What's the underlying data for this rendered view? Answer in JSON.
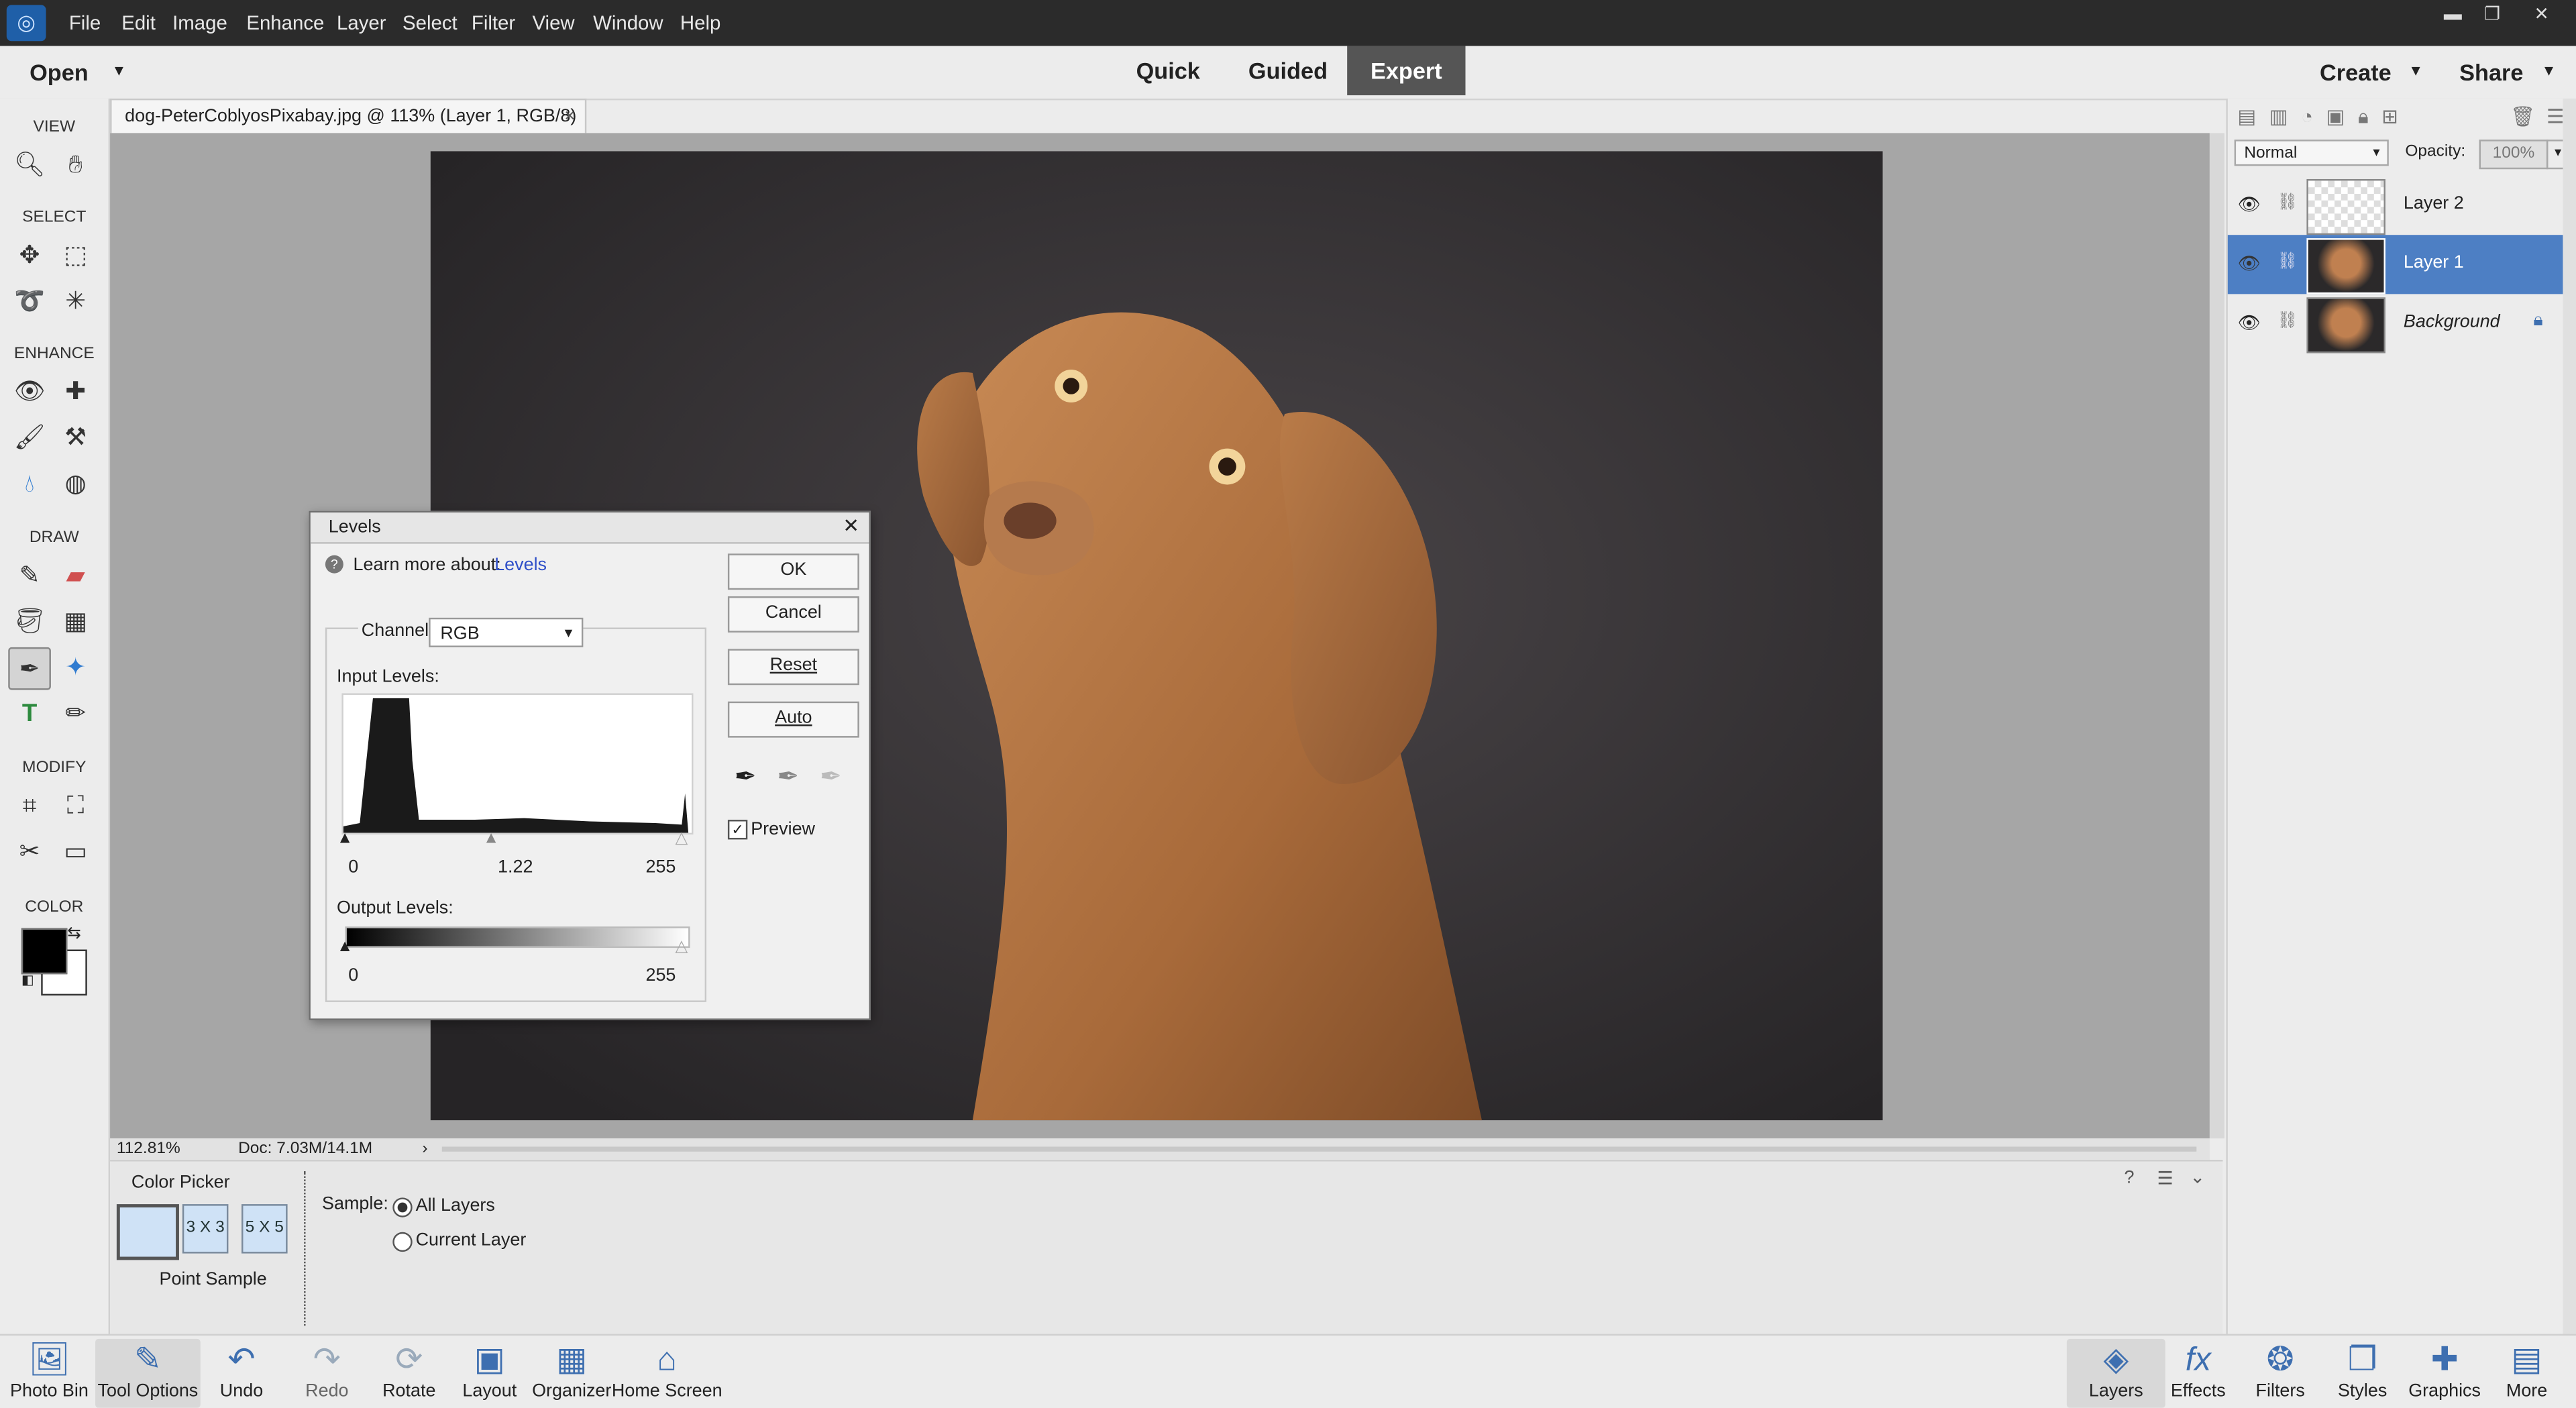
{
  "menubar": {
    "items": [
      "File",
      "Edit",
      "Image",
      "Enhance",
      "Layer",
      "Select",
      "Filter",
      "View",
      "Window",
      "Help"
    ]
  },
  "modebar": {
    "open_label": "Open",
    "tabs": [
      "Quick",
      "Guided",
      "Expert"
    ],
    "active_tab": "Expert",
    "create_label": "Create",
    "share_label": "Share"
  },
  "toolbox": {
    "sections": [
      "VIEW",
      "SELECT",
      "ENHANCE",
      "DRAW",
      "MODIFY",
      "COLOR"
    ]
  },
  "document": {
    "tab_title": "dog-PeterCoblyosPixabay.jpg @ 113% (Layer 1, RGB/8) *",
    "close_glyph": "×"
  },
  "statusbar": {
    "zoom": "112.81%",
    "doc_info": "Doc: 7.03M/14.1M",
    "arrow": "›"
  },
  "tool_options": {
    "tool_name": "Color Picker",
    "sample_sizes": [
      "3 X 3",
      "5 X 5"
    ],
    "selected_size_label": "Point Sample",
    "sample_label": "Sample:",
    "sample_options": [
      "All Layers",
      "Current Layer"
    ],
    "selected_sample": "All Layers"
  },
  "layers_panel": {
    "blend_mode": "Normal",
    "opacity_label": "Opacity:",
    "opacity_value": "100%",
    "layers": [
      {
        "name": "Layer 2",
        "selected": false
      },
      {
        "name": "Layer 1",
        "selected": true
      },
      {
        "name": "Background",
        "selected": false
      }
    ]
  },
  "levels_dialog": {
    "title": "Levels",
    "learn_more_label": "Learn more about:",
    "learn_more_link": "Levels",
    "channel_label": "Channel:",
    "channel_value": "RGB",
    "input_levels_label": "Input Levels:",
    "input_values": [
      "0",
      "1.22",
      "255"
    ],
    "output_levels_label": "Output Levels:",
    "output_values": [
      "0",
      "255"
    ],
    "buttons": {
      "ok": "OK",
      "cancel": "Cancel",
      "reset": "Reset",
      "auto": "Auto"
    },
    "preview_label": "Preview",
    "preview_checked": true
  },
  "bottombar": {
    "left": [
      "Photo Bin",
      "Tool Options",
      "Undo",
      "Redo",
      "Rotate",
      "Layout",
      "Organizer",
      "Home Screen"
    ],
    "right": [
      "Layers",
      "Effects",
      "Filters",
      "Styles",
      "Graphics",
      "More"
    ]
  }
}
